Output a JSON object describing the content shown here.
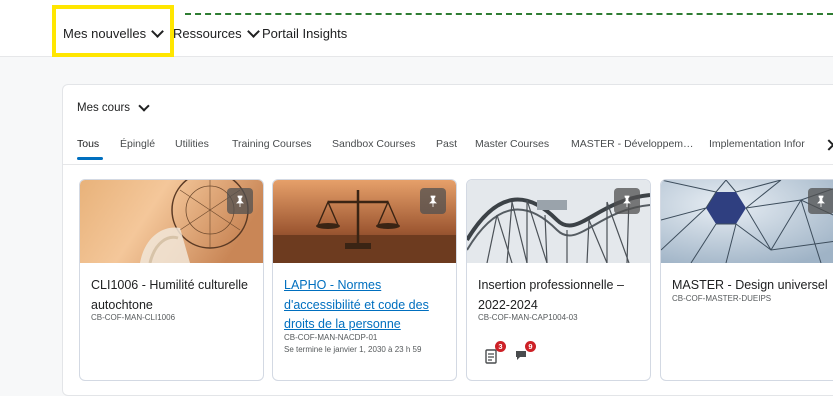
{
  "nav": {
    "items": [
      {
        "label": "Mes nouvelles",
        "dropdown": true
      },
      {
        "label": "Ressources",
        "dropdown": true
      },
      {
        "label": "Portail Insights",
        "dropdown": false
      }
    ]
  },
  "widget": {
    "title": "Mes cours",
    "tabs": [
      "Tous",
      "Épinglé",
      "Utilities",
      "Training Courses",
      "Sandbox Courses",
      "Past",
      "Master Courses",
      "MASTER - Développem…",
      "Implementation Infor"
    ],
    "active_tab": "Tous"
  },
  "courses": [
    {
      "title": "CLI1006 - Humilité culturelle autochtone",
      "code": "CB-COF-MAN-CLI1006",
      "subtitle": "",
      "link": false,
      "image": "dreamcatcher-image"
    },
    {
      "title": "LAPHO - Normes d'accessibilité et code des droits de la personne",
      "code": "CB-COF-MAN-NACDP-01",
      "subtitle": "Se termine le janvier 1, 2030 à 23 h 59",
      "link": true,
      "image": "scales-of-justice-image"
    },
    {
      "title": "Insertion professionnelle – 2022-2024",
      "code": "CB-COF-MAN-CAP1004-03",
      "subtitle": "",
      "link": false,
      "image": "roller-coaster-image",
      "notifications": [
        {
          "icon": "assignment-icon",
          "count": "3"
        },
        {
          "icon": "discussion-icon",
          "count": "9"
        }
      ]
    },
    {
      "title": "MASTER - Design universel",
      "code": "CB-COF-MASTER-DUEIPS",
      "subtitle": "",
      "link": false,
      "image": "geodesic-dome-image"
    }
  ],
  "colors": {
    "accent": "#006fbf",
    "highlight": "#ffe600",
    "dash": "#2e7d32",
    "badge": "#cd2026"
  }
}
